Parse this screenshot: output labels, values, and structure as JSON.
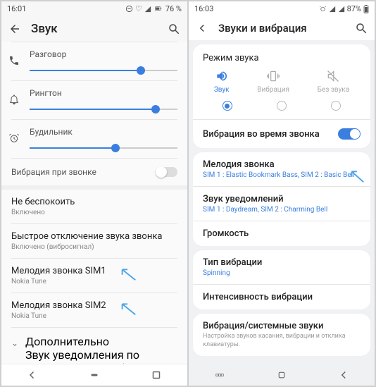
{
  "p1": {
    "time": "16:01",
    "battery": "76 %",
    "title": "Звук",
    "sliders": {
      "talk": {
        "label": "Разговор",
        "value": 75
      },
      "ring": {
        "label": "Рингтон",
        "value": 85
      },
      "alarm": {
        "label": "Будильник",
        "value": 58
      }
    },
    "vibOnCall": "Вибрация при звонке",
    "dnd": {
      "title": "Не беспокоить",
      "sub": "Включено"
    },
    "quickMute": {
      "title": "Быстрое отключение звука звонка",
      "sub": "Включено (вибросигнал)"
    },
    "sim1": {
      "title": "Мелодия звонка SIM1",
      "sub": "Nokia Tune"
    },
    "sim2": {
      "title": "Мелодия звонка SIM2",
      "sub": "Nokia Tune"
    },
    "more": {
      "title": "Дополнительно",
      "sub": "Звук уведомления по умолчанию, Звук буди…"
    }
  },
  "p2": {
    "time": "16:03",
    "battery": "87%",
    "title": "Звуки и вибрация",
    "modeHeader": "Режим звука",
    "modes": {
      "sound": "Звук",
      "vib": "Вибрация",
      "silent": "Без звука"
    },
    "vibRow": "Вибрация во время звонка",
    "ringtone": {
      "title": "Мелодия звонка",
      "sub": "SIM 1 : Elastic Bookmark Bass, SIM 2 : Basic Bell"
    },
    "notif": {
      "title": "Звук уведомлений",
      "sub": "SIM 1 : Daydream, SIM 2 : Charming Bell"
    },
    "volume": "Громкость",
    "vibType": {
      "title": "Тип вибрации",
      "sub": "Spinning"
    },
    "vibIntensity": "Интенсивность вибрации",
    "sys": {
      "title": "Вибрация/системные звуки",
      "sub": "Настройка звуков касания, вибрации и отклика клавиатуры."
    }
  }
}
